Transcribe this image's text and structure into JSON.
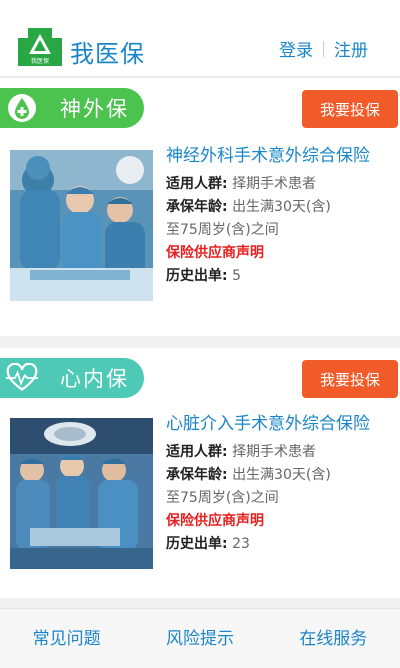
{
  "header": {
    "logo_text": "我医保",
    "brand": "我医保",
    "login": "登录",
    "register": "注册"
  },
  "products": [
    {
      "category": "神外保",
      "category_icon": "water-drop-plus-icon",
      "category_color": "#4cc24f",
      "buy_label": "我要投保",
      "title": "神经外科手术意外综合保险",
      "audience_label": "适用人群:",
      "audience": "择期手术患者",
      "age_label": "承保年龄:",
      "age": "出生满30天(含)",
      "age_cont": "至75周岁(含)之间",
      "declaration": "保险供应商声明",
      "orders_label": "历史出单:",
      "orders": "5"
    },
    {
      "category": "心内保",
      "category_icon": "heart-pulse-icon",
      "category_color": "#4dc9b6",
      "buy_label": "我要投保",
      "title": "心脏介入手术意外综合保险",
      "audience_label": "适用人群:",
      "audience": "择期手术患者",
      "age_label": "承保年龄:",
      "age": "出生满30天(含)",
      "age_cont": "至75周岁(含)之间",
      "declaration": "保险供应商声明",
      "orders_label": "历史出单:",
      "orders": "23"
    }
  ],
  "footer": {
    "faq": "常见问题",
    "risk": "风险提示",
    "service": "在线服务"
  },
  "colors": {
    "brand_blue": "#1a86c9",
    "buy_orange": "#f15a29",
    "declaration_red": "#e82020"
  }
}
